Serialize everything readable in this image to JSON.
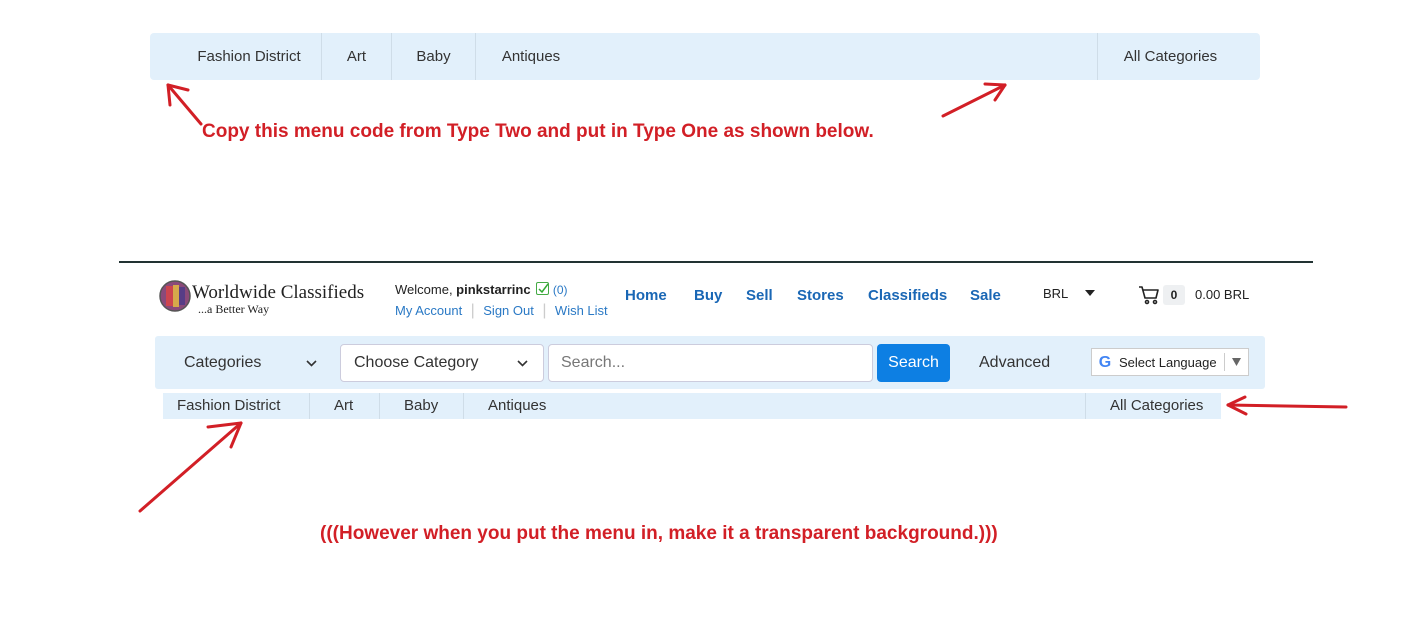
{
  "top_menu": {
    "items": [
      "Fashion District",
      "Art",
      "Baby",
      "Antiques"
    ],
    "right_item": "All Categories"
  },
  "notes": {
    "top": "Copy this menu code from Type Two and put in Type One as shown below.",
    "bottom": "(((However when you put the menu in, make it a transparent background.)))"
  },
  "header": {
    "logo_title": "Worldwide Classifieds",
    "logo_sub": "...a Better Way",
    "welcome_prefix": "Welcome, ",
    "username": "pinkstarrinc",
    "msg_count": "(0)",
    "account_links": [
      "My Account",
      "Sign Out",
      "Wish List"
    ],
    "nav": [
      "Home",
      "Buy",
      "Sell",
      "Stores",
      "Classifieds",
      "Sale"
    ],
    "currency": "BRL",
    "cart_count": "0",
    "cart_total": "0.00 BRL"
  },
  "search": {
    "categories_label": "Categories",
    "choose_category": "Choose Category",
    "placeholder": "Search...",
    "search_button": "Search",
    "advanced": "Advanced",
    "language": "Select Language"
  },
  "colors": {
    "annotation": "#d21f26",
    "menu_bg": "#e2f0fb",
    "nav_blue": "#1a67b5",
    "button_blue": "#0d7fe3"
  }
}
